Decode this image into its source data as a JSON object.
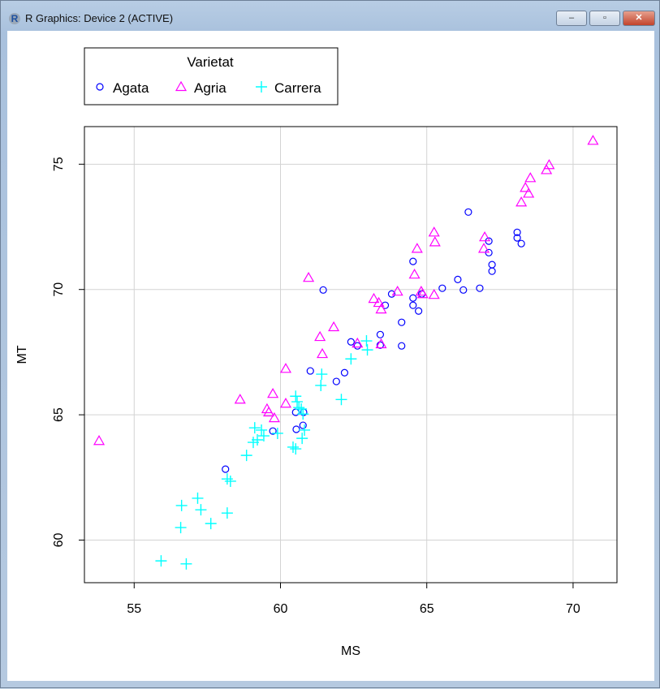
{
  "window": {
    "title": "R Graphics: Device 2 (ACTIVE)",
    "icon": "r-logo-icon",
    "minimize": "–",
    "maximize": "▫",
    "close": "✕"
  },
  "colors": {
    "Agata": "#0000ff",
    "Agria": "#ff00ff",
    "Carrera": "#00ffff"
  },
  "chart_data": {
    "type": "scatter",
    "title": "",
    "xlabel": "MS",
    "ylabel": "MT",
    "xlim": [
      53.3,
      71.5
    ],
    "ylim": [
      58.3,
      76.5
    ],
    "xticks": [
      55,
      60,
      65,
      70
    ],
    "yticks": [
      60,
      65,
      70,
      75
    ],
    "grid": true,
    "legend": {
      "title": "Varietat",
      "placement": "top-left (outside plot)",
      "entries": [
        "Agata",
        "Agria",
        "Carrera"
      ]
    },
    "series": [
      {
        "name": "Agata",
        "marker": "circle",
        "points": [
          [
            58.12,
            62.83
          ],
          [
            59.74,
            64.35
          ],
          [
            60.54,
            64.42
          ],
          [
            60.77,
            64.58
          ],
          [
            60.79,
            65.1
          ],
          [
            60.52,
            65.1
          ],
          [
            61.02,
            66.75
          ],
          [
            61.91,
            66.33
          ],
          [
            62.19,
            66.68
          ],
          [
            62.41,
            67.91
          ],
          [
            62.63,
            67.75
          ],
          [
            63.41,
            68.2
          ],
          [
            63.41,
            67.78
          ],
          [
            63.58,
            69.37
          ],
          [
            63.8,
            69.82
          ],
          [
            64.14,
            67.75
          ],
          [
            64.14,
            68.69
          ],
          [
            64.53,
            69.66
          ],
          [
            64.53,
            69.37
          ],
          [
            64.53,
            71.12
          ],
          [
            64.72,
            69.14
          ],
          [
            64.83,
            69.82
          ],
          [
            65.53,
            70.05
          ],
          [
            66.06,
            70.4
          ],
          [
            66.25,
            69.98
          ],
          [
            66.42,
            73.09
          ],
          [
            66.81,
            70.05
          ],
          [
            67.12,
            71.93
          ],
          [
            67.12,
            71.47
          ],
          [
            67.23,
            70.99
          ],
          [
            67.23,
            70.73
          ],
          [
            68.09,
            72.28
          ],
          [
            68.09,
            72.06
          ],
          [
            68.23,
            71.83
          ],
          [
            61.46,
            69.98
          ]
        ]
      },
      {
        "name": "Agria",
        "marker": "triangle",
        "points": [
          [
            53.8,
            63.96
          ],
          [
            58.62,
            65.61
          ],
          [
            59.54,
            65.23
          ],
          [
            59.6,
            65.1
          ],
          [
            59.74,
            65.84
          ],
          [
            59.79,
            64.87
          ],
          [
            60.18,
            65.45
          ],
          [
            60.18,
            66.84
          ],
          [
            60.96,
            70.47
          ],
          [
            61.35,
            68.11
          ],
          [
            61.43,
            67.43
          ],
          [
            61.82,
            68.5
          ],
          [
            62.63,
            67.85
          ],
          [
            63.19,
            69.63
          ],
          [
            63.36,
            69.47
          ],
          [
            63.44,
            69.21
          ],
          [
            63.44,
            67.82
          ],
          [
            64.0,
            69.92
          ],
          [
            64.58,
            70.6
          ],
          [
            64.67,
            71.63
          ],
          [
            64.81,
            69.92
          ],
          [
            64.86,
            69.82
          ],
          [
            65.25,
            72.28
          ],
          [
            65.28,
            71.89
          ],
          [
            65.25,
            69.79
          ],
          [
            66.98,
            72.09
          ],
          [
            66.95,
            71.63
          ],
          [
            68.23,
            73.48
          ],
          [
            68.37,
            74.06
          ],
          [
            68.48,
            73.83
          ],
          [
            68.54,
            74.45
          ],
          [
            69.09,
            74.77
          ],
          [
            69.18,
            74.97
          ],
          [
            70.68,
            75.94
          ]
        ]
      },
      {
        "name": "Carrera",
        "marker": "plus",
        "points": [
          [
            55.92,
            59.17
          ],
          [
            56.78,
            59.05
          ],
          [
            56.59,
            60.5
          ],
          [
            56.62,
            61.38
          ],
          [
            57.17,
            61.67
          ],
          [
            57.28,
            61.21
          ],
          [
            57.62,
            60.66
          ],
          [
            58.18,
            61.08
          ],
          [
            58.18,
            62.44
          ],
          [
            58.29,
            62.35
          ],
          [
            58.84,
            63.38
          ],
          [
            59.12,
            64.48
          ],
          [
            59.07,
            63.9
          ],
          [
            59.21,
            64.0
          ],
          [
            59.35,
            64.39
          ],
          [
            59.43,
            64.16
          ],
          [
            59.9,
            64.26
          ],
          [
            60.43,
            63.71
          ],
          [
            60.52,
            63.64
          ],
          [
            60.52,
            65.74
          ],
          [
            60.57,
            65.52
          ],
          [
            60.63,
            65.29
          ],
          [
            60.77,
            65.03
          ],
          [
            60.71,
            65.23
          ],
          [
            60.82,
            64.39
          ],
          [
            60.74,
            64.06
          ],
          [
            61.41,
            66.62
          ],
          [
            61.38,
            66.17
          ],
          [
            62.08,
            65.61
          ],
          [
            62.41,
            67.23
          ],
          [
            62.94,
            67.95
          ],
          [
            62.97,
            67.59
          ]
        ]
      }
    ]
  }
}
